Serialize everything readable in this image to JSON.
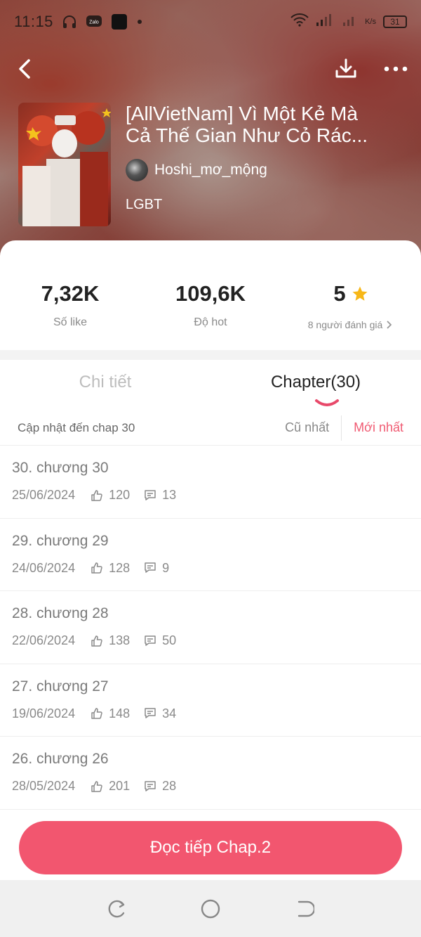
{
  "status_bar": {
    "time": "11:15",
    "battery": "31",
    "net_speed": "K/s"
  },
  "book": {
    "title": "[AllVietNam] Vì Một Kẻ Mà Cả Thế Gian Như Cỏ Rác...",
    "author": "Hoshi_mơ_mộng",
    "genre": "LGBT"
  },
  "stats": {
    "likes": {
      "value": "7,32K",
      "label": "Số like"
    },
    "hot": {
      "value": "109,6K",
      "label": "Độ hot"
    },
    "rating": {
      "value": "5",
      "label": "8 người đánh giá",
      "star_color": "#f7b718"
    }
  },
  "tabs": {
    "detail": "Chi tiết",
    "chapters": "Chapter(30)",
    "active": "chapters"
  },
  "sort": {
    "updated": "Cập nhật đến chap 30",
    "oldest": "Cũ nhất",
    "newest": "Mới nhất",
    "active": "newest"
  },
  "chapters": [
    {
      "title": "30. chương 30",
      "date": "25/06/2024",
      "likes": "120",
      "comments": "13"
    },
    {
      "title": "29. chương 29",
      "date": "24/06/2024",
      "likes": "128",
      "comments": "9"
    },
    {
      "title": "28. chương 28",
      "date": "22/06/2024",
      "likes": "138",
      "comments": "50"
    },
    {
      "title": "27. chương 27",
      "date": "19/06/2024",
      "likes": "148",
      "comments": "34"
    },
    {
      "title": "26. chương 26",
      "date": "28/05/2024",
      "likes": "201",
      "comments": "28"
    }
  ],
  "cta": {
    "label": "Đọc tiếp Chap.2",
    "color": "#f2566f"
  },
  "colors": {
    "accent": "#f05a72",
    "tab_indicator": "#e8496a"
  },
  "icons": {
    "back": "back-arrow-icon",
    "download": "download-icon",
    "more": "more-dots-icon",
    "star": "star-icon",
    "like": "thumb-up-icon",
    "comment": "comment-icon"
  }
}
